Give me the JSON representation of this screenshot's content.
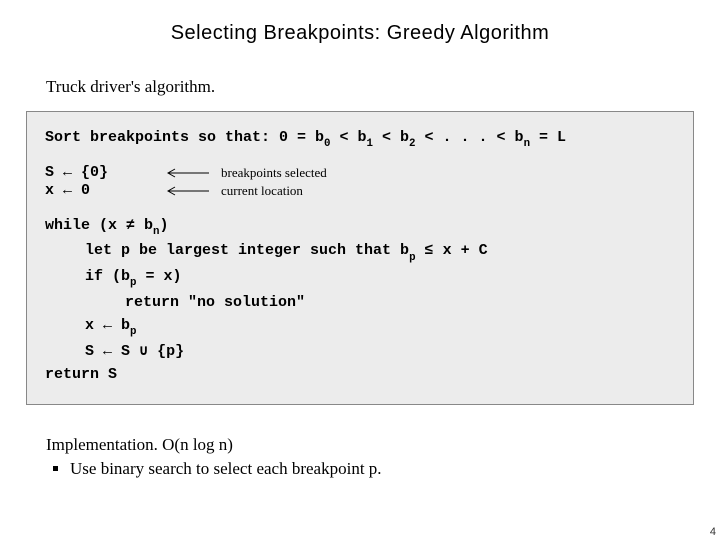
{
  "title": "Selecting Breakpoints:  Greedy Algorithm",
  "section_heading": "Truck driver's algorithm.",
  "code": {
    "sort_prefix": "Sort breakpoints so that: 0 = b",
    "sort_mid1": " < b",
    "sort_mid2": " < b",
    "sort_mid3": " < . . . < b",
    "sort_suffix": " = L",
    "s_sub0": "0",
    "s_sub1": "1",
    "s_sub2": "2",
    "s_subn": "n",
    "init_S_lhs": "S ",
    "init_S_rhs": " {0}",
    "init_x_lhs": "x ",
    "init_x_rhs": " 0",
    "annot_S": "breakpoints selected",
    "annot_x": "current location",
    "while_prefix": "while (x ",
    "while_neq": "≠",
    "while_b": " b",
    "while_suffix": ")",
    "let_prefix": "let p be largest integer such that b",
    "let_sub": "p",
    "let_le": " ≤",
    "let_suffix": " x + C",
    "if_prefix": "if (b",
    "if_sub": "p",
    "if_suffix": " = x)",
    "return_nosol": "return \"no solution\"",
    "x_assign_lhs": "x ",
    "x_assign_b": " b",
    "x_assign_sub": "p",
    "S_assign_lhs": "S ",
    "S_assign_rhs1": " S ",
    "S_union": "∪",
    "S_assign_rhs2": " {p}",
    "return_S": "return S",
    "arrow": "←"
  },
  "impl_label": "Implementation.",
  "impl_text": "  O(n log n)",
  "bullet1": "Use binary search to select each breakpoint p.",
  "pagenum": "4"
}
